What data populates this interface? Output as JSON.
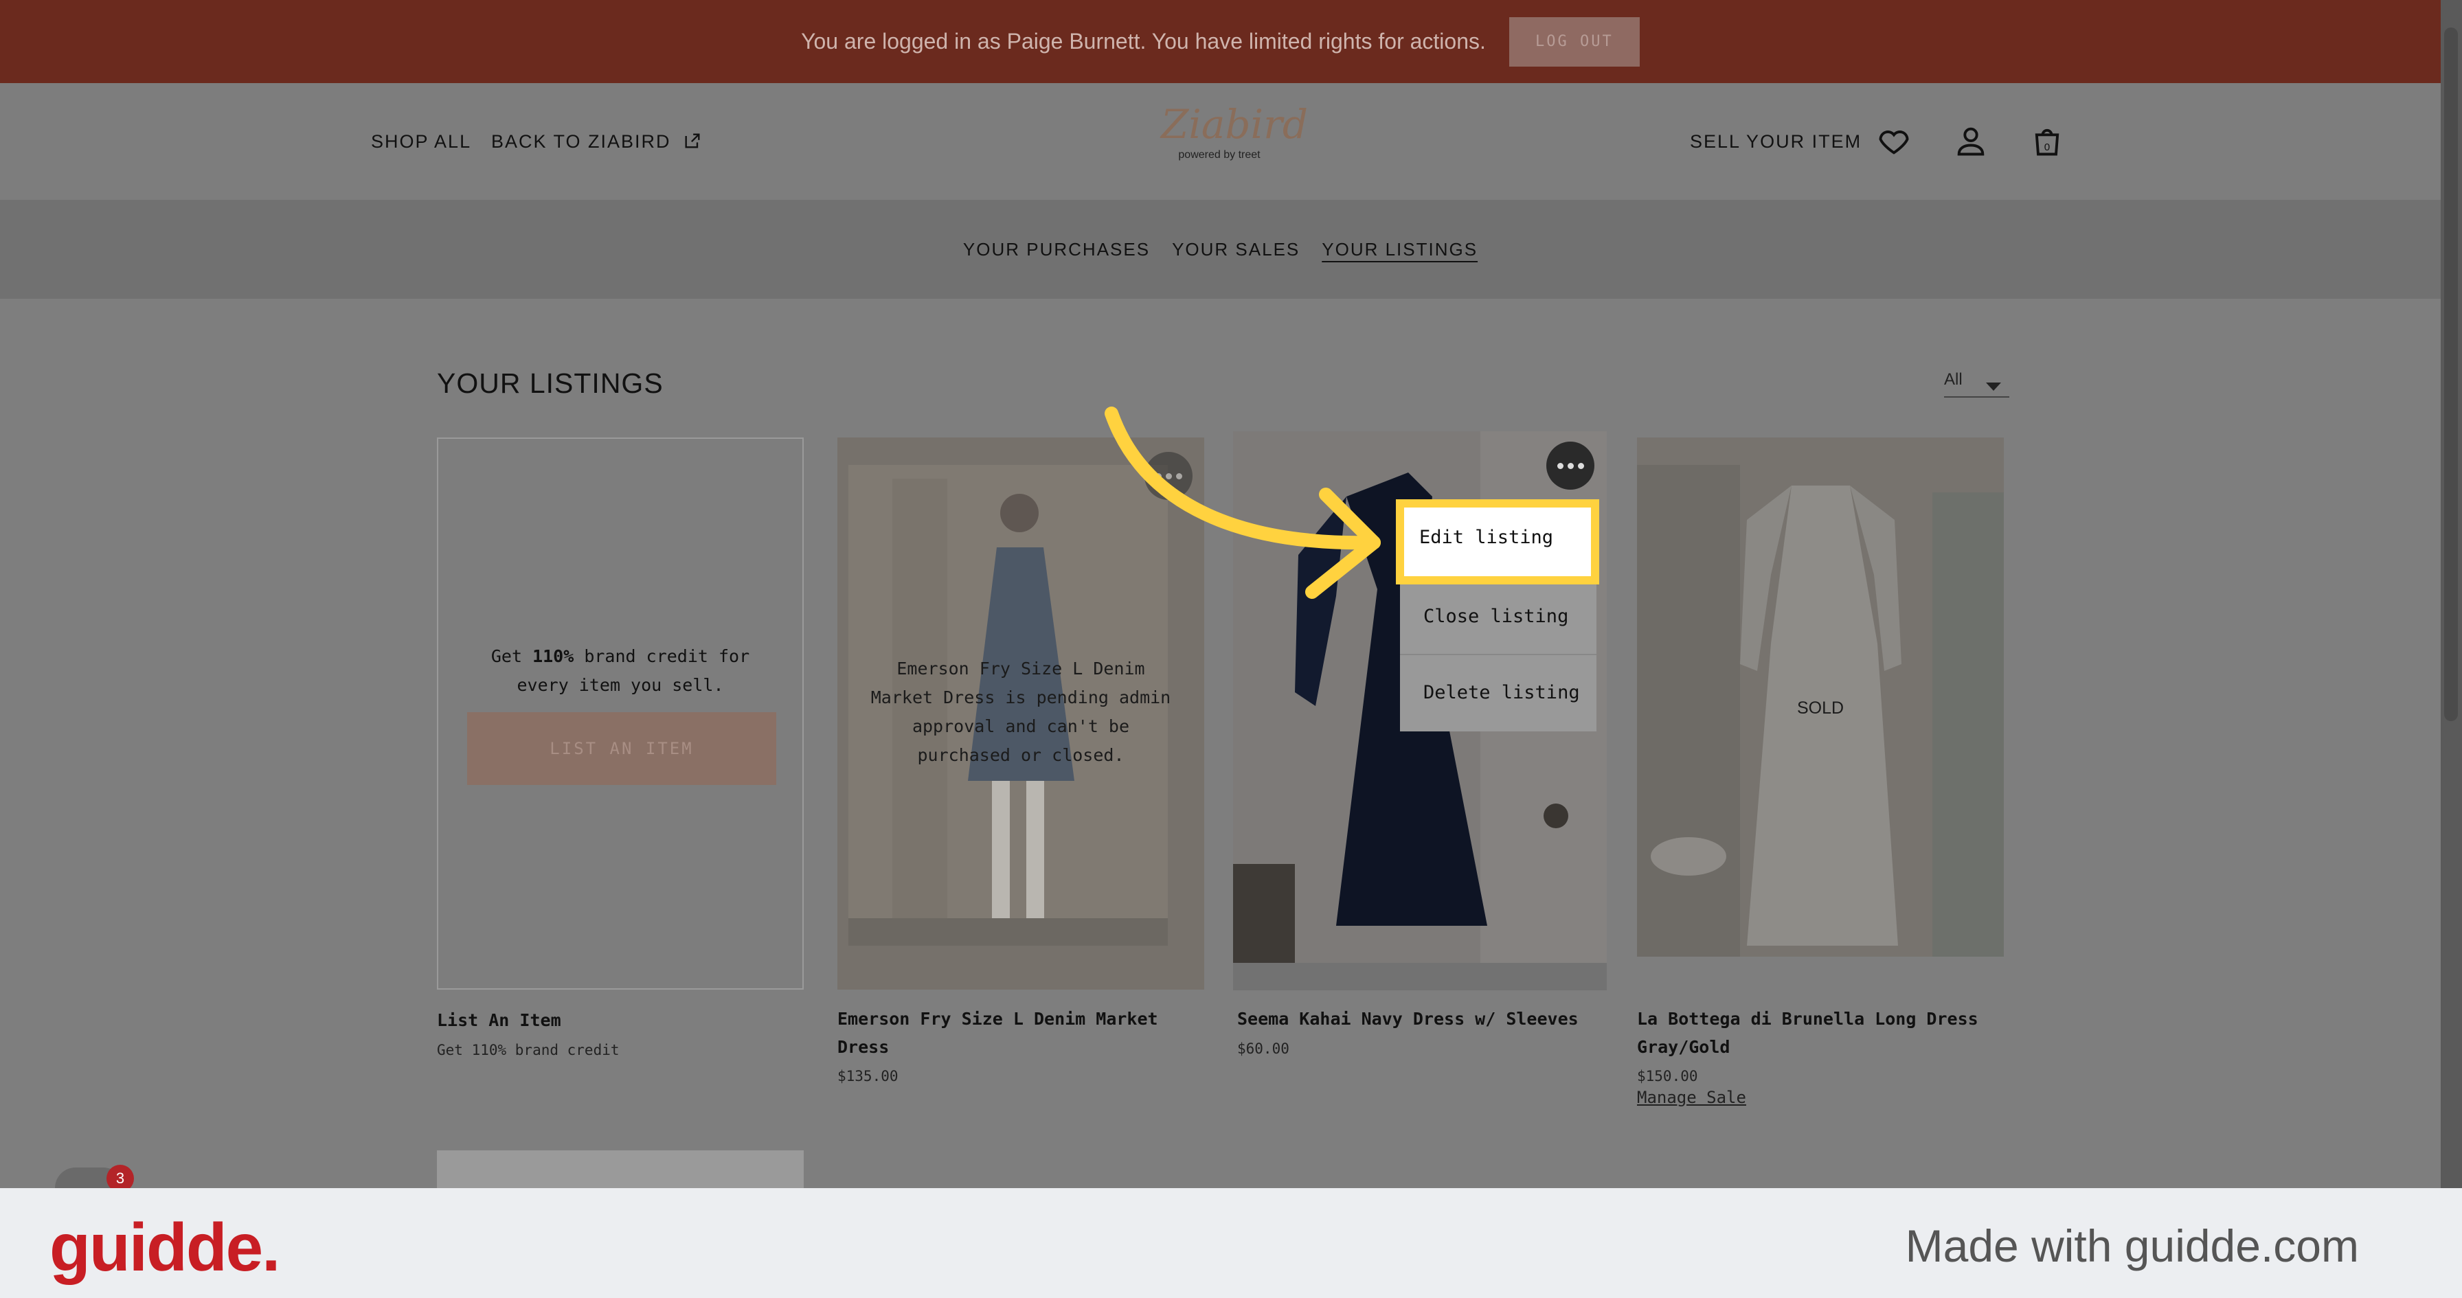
{
  "banner": {
    "message": "You are logged in as Paige Burnett. You have limited rights for actions.",
    "logout_label": "LOG OUT"
  },
  "header": {
    "shop_all": "SHOP ALL",
    "back_to": "BACK TO ZIABIRD",
    "logo_script": "Ziabird",
    "logo_powered": "powered by treet",
    "sell": "SELL YOUR ITEM",
    "cart_count": "0"
  },
  "subnav": {
    "purchases": "YOUR PURCHASES",
    "sales": "YOUR SALES",
    "listings": "YOUR LISTINGS"
  },
  "page": {
    "title": "YOUR LISTINGS",
    "filter_value": "All"
  },
  "cards": {
    "list_item": {
      "promo_prefix": "Get ",
      "promo_bold": "110%",
      "promo_suffix": " brand credit for every item you sell.",
      "button": "LIST AN ITEM",
      "title": "List An Item",
      "subtitle": "Get 110% brand credit"
    },
    "emerson": {
      "overlay": "Emerson Fry Size L Denim Market Dress is pending admin approval and can't be purchased or closed.",
      "title": "Emerson Fry Size L Denim Market Dress",
      "price": "$135.00"
    },
    "seema": {
      "title": "Seema Kahai Navy Dress w/ Sleeves",
      "price": "$60.00"
    },
    "bottega": {
      "overlay": "SOLD",
      "title": "La Bottega di Brunella Long Dress Gray/Gold",
      "price": "$150.00",
      "link": "Manage Sale"
    }
  },
  "dropdown": {
    "edit": "Edit listing",
    "close": "Close listing",
    "delete": "Delete listing"
  },
  "chat": {
    "badge": "3"
  },
  "footer": {
    "logo": "guidde.",
    "made_with": "Made with guidde.com"
  },
  "colors": {
    "banner": "#6b2a1e",
    "highlight": "#ffd23f",
    "guidde_red": "#c81e24"
  }
}
